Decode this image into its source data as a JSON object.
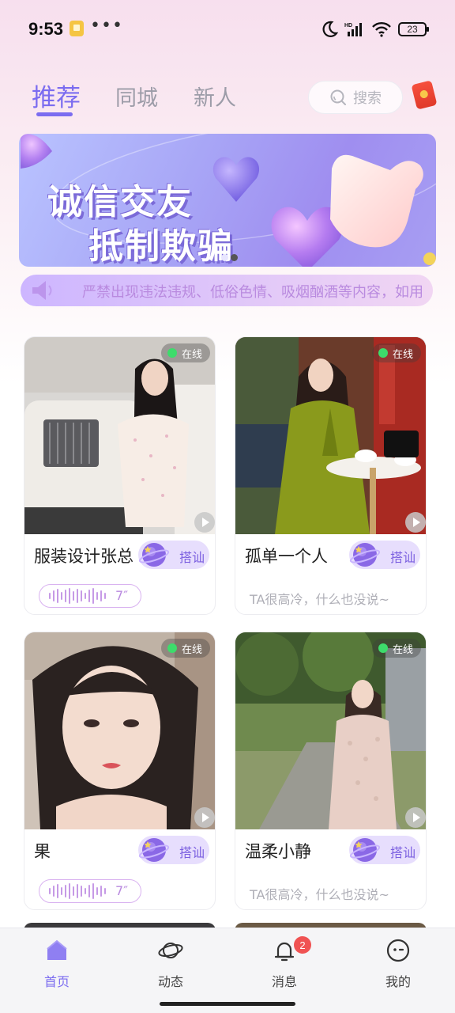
{
  "status_bar": {
    "time": "9:53",
    "more": "•••",
    "battery": "23"
  },
  "top_nav": {
    "tabs": [
      {
        "label": "推荐",
        "active": true
      },
      {
        "label": "同城",
        "active": false
      },
      {
        "label": "新人",
        "active": false
      }
    ],
    "search_label": "搜索",
    "accent_color": "#7b6cf0"
  },
  "banner": {
    "line1": "诚信交友",
    "line2": "抵制欺骗"
  },
  "notice": {
    "text": "严禁出现违法违规、低俗色情、吸烟酗酒等内容，如用"
  },
  "cards": [
    {
      "name": "服装设计张总",
      "online": "在线",
      "greet": "搭讪",
      "voice_duration": "7″",
      "bio": ""
    },
    {
      "name": "孤单一个人",
      "online": "在线",
      "greet": "搭讪",
      "voice_duration": "",
      "bio": "TA很高冷，什么也没说~"
    },
    {
      "name": "果",
      "online": "在线",
      "greet": "搭讪",
      "voice_duration": "7″",
      "bio": ""
    },
    {
      "name": "温柔小静",
      "online": "在线",
      "greet": "搭讪",
      "voice_duration": "",
      "bio": "TA很高冷，什么也没说~"
    }
  ],
  "bottom_nav": {
    "items": [
      {
        "label": "首页",
        "icon": "home-icon",
        "active": true
      },
      {
        "label": "动态",
        "icon": "planet-icon",
        "active": false
      },
      {
        "label": "消息",
        "icon": "bell-icon",
        "active": false,
        "badge": "2"
      },
      {
        "label": "我的",
        "icon": "face-icon",
        "active": false
      }
    ]
  }
}
